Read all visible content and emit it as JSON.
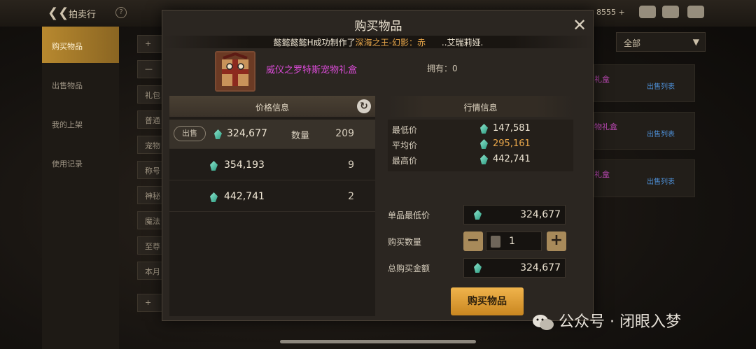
{
  "topbar": {
    "title": "拍卖行",
    "currency": "8555 +"
  },
  "leftnav": {
    "items": [
      {
        "label": "购买物品",
        "active": true
      },
      {
        "label": "出售物品",
        "active": false
      },
      {
        "label": "我的上架",
        "active": false
      },
      {
        "label": "使用记录",
        "active": false
      }
    ]
  },
  "subnav": {
    "items": [
      "+",
      "—",
      "礼包",
      "普通",
      "宠物",
      "称号",
      "神秘",
      "魔法",
      "至尊",
      "本月",
      "+"
    ]
  },
  "right_panel": {
    "dropdown": "全部",
    "cards": [
      {
        "name": "礼盒",
        "action": "出售列表"
      },
      {
        "name": "物礼盒",
        "action": "出售列表"
      },
      {
        "name": "礼盒",
        "action": "出售列表"
      }
    ]
  },
  "modal": {
    "title": "购买物品",
    "ticker": {
      "prefix": "懿懿懿懿H成功制作了",
      "highlight": "深海之王-幻影：赤",
      "suffix": "..艾瑞莉娅."
    },
    "item": {
      "name": "威仪之罗特斯宠物礼盒",
      "owned": "拥有：0"
    },
    "price_info": {
      "header": "价格信息",
      "rows": [
        {
          "badge": "出售",
          "price": "324,677",
          "qty_label": "数量",
          "qty": "209"
        },
        {
          "badge": "",
          "price": "354,193",
          "qty_label": "",
          "qty": "9"
        },
        {
          "badge": "",
          "price": "442,741",
          "qty_label": "",
          "qty": "2"
        }
      ]
    },
    "market_info": {
      "header": "行情信息",
      "rows": [
        {
          "label": "最低价",
          "value": "147,581"
        },
        {
          "label": "平均价",
          "value": "295,161"
        },
        {
          "label": "最高价",
          "value": "442,741"
        }
      ]
    },
    "buy_form": {
      "unit_min_label": "单品最低价",
      "unit_min_value": "324,677",
      "qty_label": "购买数量",
      "qty_value": "1",
      "total_label": "总购买金额",
      "total_value": "324,677",
      "buy_button": "购买物品"
    }
  },
  "watermark": "公众号 · 闭眼入梦"
}
